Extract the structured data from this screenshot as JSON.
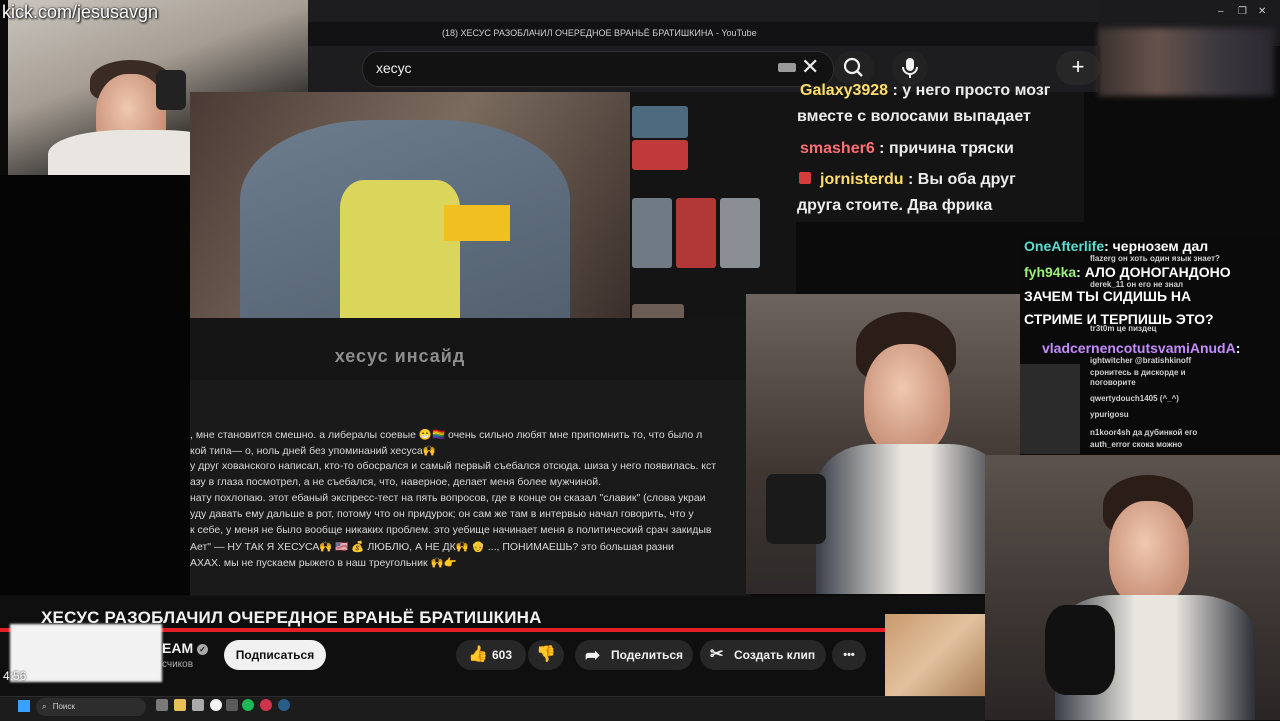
{
  "overlay": {
    "kick_label": "kick.com/jesusavgn"
  },
  "browser": {
    "tab_title": "(18) ХЕСУС РАЗОБЛАЧИЛ ОЧЕРЕДНОЕ ВРАНЬЁ БРАТИШКИНА - YouTube",
    "search_value": "хесус",
    "icons": [
      "keyboard-icon",
      "close-icon",
      "search-icon",
      "mic-icon",
      "plus-icon"
    ],
    "accent": "#e41f25"
  },
  "stream_chat_top": {
    "messages": [
      {
        "user": "Galaxy3928",
        "text": ": у него просто мозг"
      },
      {
        "user": "",
        "text": "вместе с волосами выпадает"
      },
      {
        "user": "smasher6",
        "text": ": причина тряски"
      },
      {
        "user": "jornisterdu",
        "text": ": Вы оба друг"
      },
      {
        "user": "",
        "text": "друга стоите. Два фрика"
      }
    ]
  },
  "embedded_post": {
    "watermark": "хесус инсайд",
    "lines": [
      ", мне становится смешно. а либералы соевые 😁🏳️‍🌈 очень сильно любят мне припомнить то, что было л",
      "кой типа— о, ноль дней без упоминаний хесуса🙌",
      "у друг хованского написал, кто-то обосрался и самый первый съебался отсюда. шиза у него появилась. кст",
      "азу в глаза посмотрел, а не съебался, что, наверное, делает меня более мужчиной.",
      "нату похлопаю. этот ебаный экспресс-тест на пять вопросов, где в конце он сказал \"славик\" (слова украи",
      "уду давать ему дальше в рот, потому что он придурок; он сам же там в интервью начал говорить, что у",
      "к себе, у меня не было вообще никаких проблем. это уебище начинает меня в политический срач закидыв",
      "Ает\" — НУ ТАК Я ХЕСУСА🙌 🇺🇸 💰 ЛЮБЛЮ, А НЕ ДК🙌 👴 ..., ПОНИМАЕШЬ? это большая разни",
      "АХАХ. мы не пускаем рыжего в наш треугольник 🙌👉"
    ]
  },
  "stream_chat_right": {
    "messages": [
      {
        "user": "OneAfterlife",
        "text": ": чернозем дал"
      },
      {
        "user": "fyh94ka",
        "text": ": АЛО ДОНОГАНДОНО"
      },
      {
        "user": "",
        "text": "ЗАЧЕМ ТЫ СИДИШЬ НА"
      },
      {
        "user": "",
        "text": "СТРИМЕ И ТЕРПИШЬ ЭТО?"
      },
      {
        "user": "vladcernencotutsvamiAnudA",
        "text": ":"
      }
    ],
    "small_messages": [
      "flazerg он хоть один язык знает?",
      "derek_11 он его не знал",
      "tr3t0m це пиздец",
      "ightwitcher @bratishkinoff",
      "сронитесь в дискорде и",
      "поговорите",
      "qwertydouch1405 (^_^)",
      "ypurigosu",
      "n1koor4sh да дубинкой его",
      "auth_error скока можно"
    ]
  },
  "youtube_player": {
    "video_title": "ХЕСУС РАЗОБЛАЧИЛ ОЧЕРЕДНОЕ ВРАНЬЁ БРАТИШКИНА",
    "channel_name_partial": "EAM",
    "subscribers_partial": "счиков",
    "subscribe_label": "Подписаться",
    "likes": "603",
    "share_label": "Поделиться",
    "clip_label": "Создать клип",
    "more_label": "•••",
    "time": "4:56"
  },
  "taskbar": {
    "search_label": "Поиск"
  }
}
